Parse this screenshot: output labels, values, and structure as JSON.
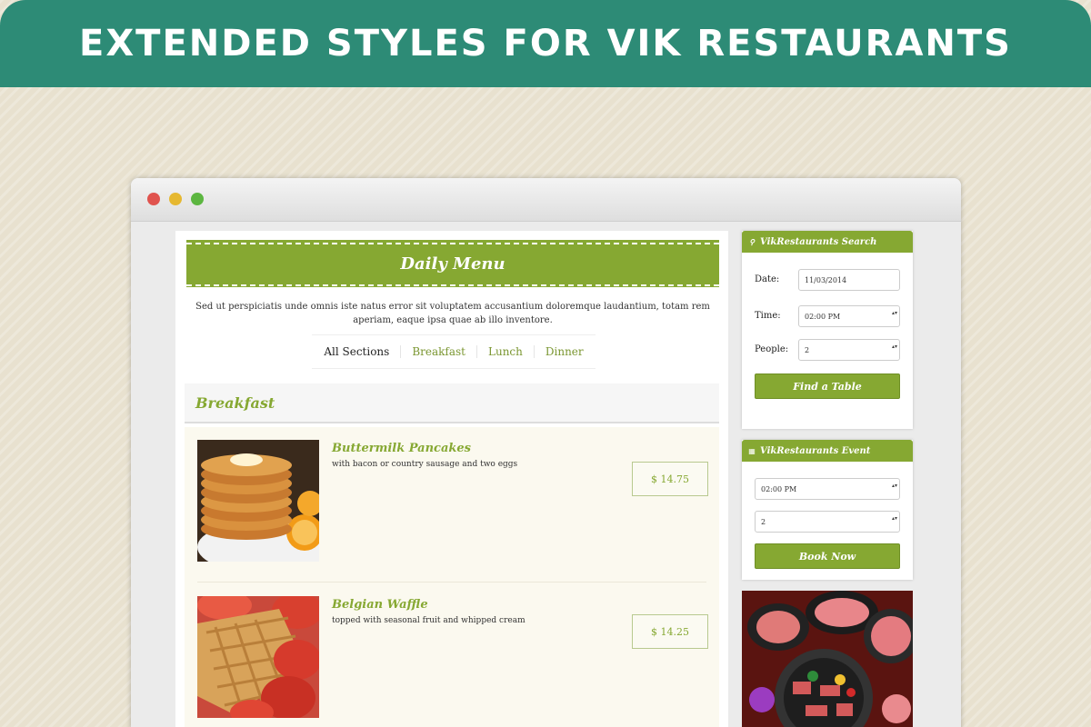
{
  "banner": {
    "title": "EXTENDED STYLES FOR VIK RESTAURANTS"
  },
  "menu": {
    "title": "Daily Menu",
    "intro": "Sed ut perspiciatis unde omnis iste natus error sit voluptatem accusantium doloremque laudantium, totam rem aperiam, eaque ipsa quae ab illo inventore.",
    "tabs": [
      "All Sections",
      "Breakfast",
      "Lunch",
      "Dinner"
    ],
    "section_title": "Breakfast",
    "items": [
      {
        "name": "Buttermilk Pancakes",
        "desc": "with bacon or country sausage and two eggs",
        "price": "$ 14.75"
      },
      {
        "name": "Belgian Waffle",
        "desc": "topped with seasonal fruit and whipped cream",
        "price": "$ 14.25"
      }
    ]
  },
  "search_widget": {
    "title": "VikRestaurants Search",
    "date_label": "Date:",
    "date_value": "11/03/2014",
    "time_label": "Time:",
    "time_value": "02:00 PM",
    "people_label": "People:",
    "people_value": "2",
    "button": "Find a Table"
  },
  "event_widget": {
    "title": "VikRestaurants Event",
    "time_value": "02:00 PM",
    "people_value": "2",
    "button": "Book Now"
  },
  "colors": {
    "banner": "#2d8b76",
    "accent": "#86a832",
    "background": "#e8e1cf"
  }
}
